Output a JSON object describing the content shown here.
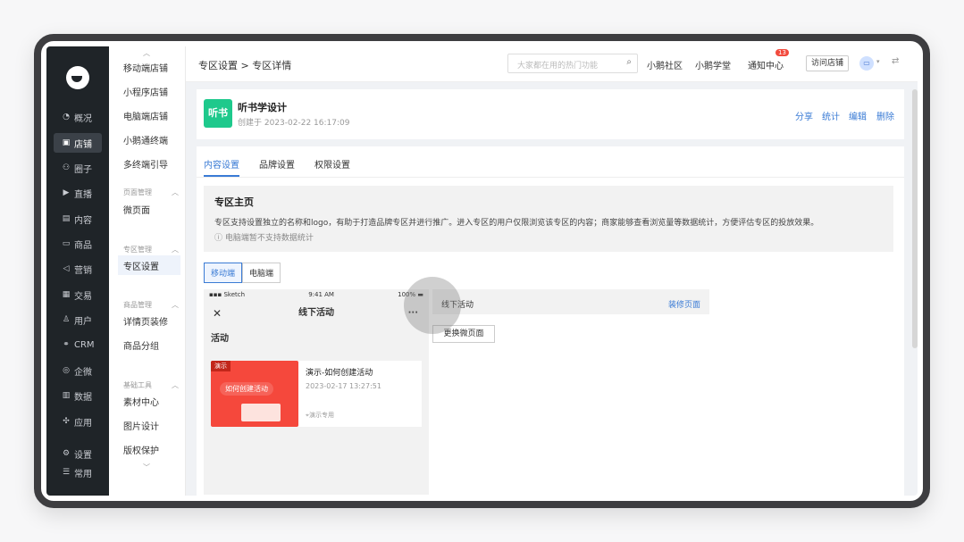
{
  "primary_nav": [
    {
      "label": "概况",
      "icon": "chart-pie-icon"
    },
    {
      "label": "店铺",
      "icon": "store-icon",
      "active": true
    },
    {
      "label": "圈子",
      "icon": "group-icon"
    },
    {
      "label": "直播",
      "icon": "live-icon"
    },
    {
      "label": "内容",
      "icon": "content-icon"
    },
    {
      "label": "商品",
      "icon": "goods-icon"
    },
    {
      "label": "营销",
      "icon": "megaphone-icon"
    },
    {
      "label": "交易",
      "icon": "trade-icon"
    },
    {
      "label": "用户",
      "icon": "user-icon"
    },
    {
      "label": "CRM",
      "icon": "crm-icon"
    },
    {
      "label": "企微",
      "icon": "wecom-icon"
    },
    {
      "label": "数据",
      "icon": "data-icon"
    },
    {
      "label": "应用",
      "icon": "apps-icon"
    },
    {
      "label": "设置",
      "icon": "gear-icon"
    },
    {
      "label": "常用",
      "icon": "list-icon"
    }
  ],
  "secondary_nav": {
    "items_top": [
      "移动端店铺",
      "小程序店铺",
      "电脑端店铺",
      "小鹅通终端",
      "多终端引导"
    ],
    "group_page": "页面管理",
    "items_page": [
      "微页面"
    ],
    "group_zone": "专区管理",
    "items_zone": [
      "专区设置"
    ],
    "group_goods": "商品管理",
    "items_goods": [
      "详情页装修",
      "商品分组"
    ],
    "group_tools": "基础工具",
    "items_tools": [
      "素材中心",
      "图片设计",
      "版权保护"
    ]
  },
  "topbar": {
    "breadcrumb": "专区设置 > 专区详情",
    "search_placeholder": "大家都在用的热门功能",
    "link_community": "小鹅社区",
    "link_school": "小鹅学堂",
    "link_notice": "通知中心",
    "notice_count": "13",
    "visit_button": "访问店铺"
  },
  "zone": {
    "logo_text": "听书",
    "title": "听书学设计",
    "created": "创建于 2023-02-22 16:17:09",
    "actions": [
      "分享",
      "统计",
      "编辑",
      "删除"
    ]
  },
  "tabs": [
    "内容设置",
    "品牌设置",
    "权限设置"
  ],
  "info": {
    "title": "专区主页",
    "desc": "专区支持设置独立的名称和logo，有助于打造品牌专区并进行推广。进入专区的用户仅限浏览该专区的内容；商家能够查看浏览量等数据统计，方便评估专区的投放效果。",
    "note": "电脑端暂不支持数据统计"
  },
  "segment": [
    "移动端",
    "电脑端"
  ],
  "phone": {
    "carrier": "Sketch",
    "time": "9:41 AM",
    "battery": "100%",
    "title": "线下活动",
    "section": "活动",
    "card_tag": "演示",
    "card_image_text": "如何创建活动",
    "card_name": "演示-如何创建活动",
    "card_date": "2023-02-17 13:27:51",
    "card_location": "演示专用"
  },
  "right_panel": {
    "label": "线下活动",
    "decorate": "装修页面",
    "change_button": "更换微页面"
  },
  "colors": {
    "accent": "#3a7bd5",
    "brand_green": "#1ec98c",
    "nav_dark": "#1f2428"
  }
}
